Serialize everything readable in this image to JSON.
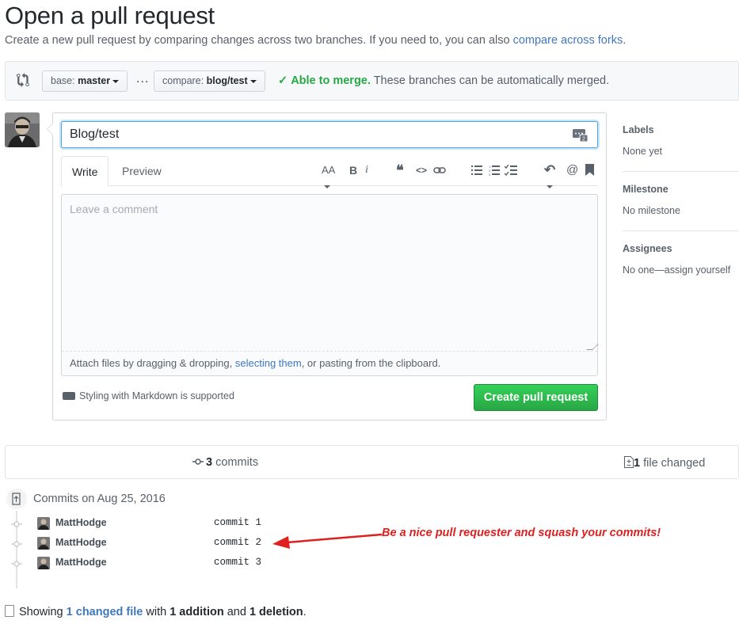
{
  "header": {
    "title": "Open a pull request",
    "subtitle": "Create a new pull request by comparing changes across two branches. If you need to, you can also",
    "subtitle_link": "compare across forks",
    "subtitle_end": "."
  },
  "range": {
    "base_prefix": "base:",
    "base_branch": "master",
    "dots": "...",
    "compare_prefix": "compare:",
    "compare_branch": "blog/test",
    "merge_status": "Able to merge.",
    "merge_detail": "These branches can be automatically merged."
  },
  "form": {
    "title_value": "Blog/test",
    "tabs": {
      "write": "Write",
      "preview": "Preview"
    },
    "toolbar": {
      "heading": "AA",
      "bold": "B",
      "italic": "i",
      "quote": "❝",
      "code": "<>",
      "link": "🔗",
      "unordered_list": "☰",
      "ordered_list": "☷",
      "task_list": "☑",
      "reply": "↶",
      "mention": "@",
      "bookmark": "🔖"
    },
    "comment_placeholder": "Leave a comment",
    "attach_prefix": "Attach files by dragging & dropping,",
    "attach_link": "selecting them",
    "attach_suffix": ", or pasting from the clipboard.",
    "markdown_note": "Styling with Markdown is supported",
    "submit_label": "Create pull request"
  },
  "sidebar": {
    "labels": {
      "heading": "Labels",
      "value": "None yet"
    },
    "milestone": {
      "heading": "Milestone",
      "value": "No milestone"
    },
    "assignees": {
      "heading": "Assignees",
      "value": "No one—assign yourself"
    }
  },
  "summary": {
    "commits_count": "3",
    "commits_label": "commits",
    "files_count": "1",
    "files_label": "file changed"
  },
  "commits": {
    "date_heading": "Commits on Aug 25, 2016",
    "items": [
      {
        "author": "MattHodge",
        "message": "commit 1"
      },
      {
        "author": "MattHodge",
        "message": "commit 2"
      },
      {
        "author": "MattHodge",
        "message": "commit 3"
      }
    ]
  },
  "annotation": {
    "text": "Be a nice pull requester and squash your commits!",
    "color": "#e02020"
  },
  "footer": {
    "prefix": "Showing",
    "link": "1 changed file",
    "mid": "with",
    "additions": "1 addition",
    "and": "and",
    "deletions": "1 deletion",
    "end": "."
  },
  "colors": {
    "link": "#4078c0",
    "success": "#28a745",
    "button_green": "#2cbe4e"
  }
}
